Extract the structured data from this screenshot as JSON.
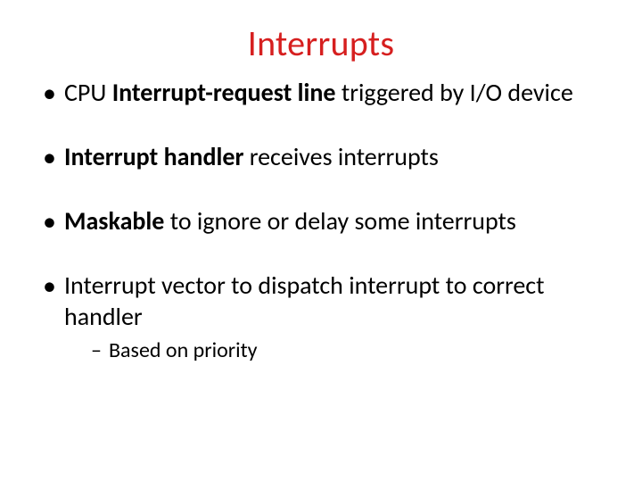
{
  "title": "Interrupts",
  "bullets": {
    "b1": {
      "t1": "CPU ",
      "bold": "Interrupt-request line",
      "t2": " triggered by I/O device"
    },
    "b2": {
      "bold": "Interrupt handler",
      "t2": " receives interrupts"
    },
    "b3": {
      "bold": "Maskable",
      "t2": " to ignore or delay some interrupts"
    },
    "b4": {
      "t1": "Interrupt vector to dispatch interrupt to correct handler",
      "sub1": "Based on priority"
    }
  }
}
